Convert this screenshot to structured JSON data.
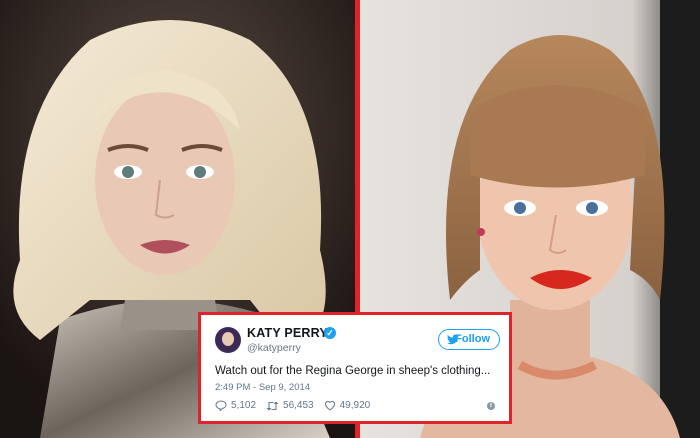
{
  "colors": {
    "frame": "#e0222b",
    "twitter_blue": "#1da1f2",
    "muted": "#657786"
  },
  "photos": {
    "left": {
      "subject": "woman-portrait-platinum-blonde-hair"
    },
    "right": {
      "subject": "woman-portrait-bob-haircut-red-lips"
    }
  },
  "tweet": {
    "name": "KATY PERRY",
    "handle": "@katyperry",
    "follow_label": "Follow",
    "text": "Watch out for the Regina George in sheep's clothing...",
    "timestamp": "2:49 PM - Sep 9, 2014",
    "replies": "5,102",
    "retweets": "56,453",
    "likes": "49,920",
    "icons": [
      "verified-icon",
      "twitter-bird-icon",
      "reply-icon",
      "retweet-icon",
      "heart-icon",
      "info-icon"
    ]
  }
}
